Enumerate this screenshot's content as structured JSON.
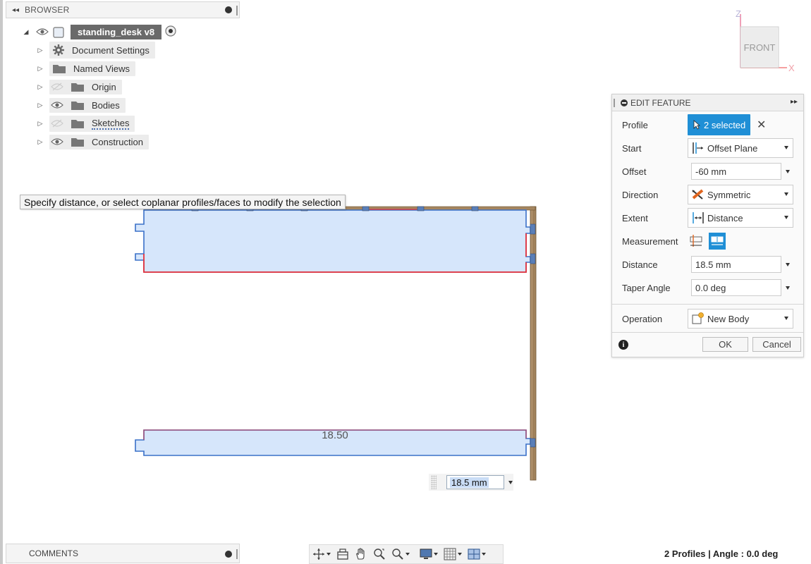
{
  "browser": {
    "title": "BROWSER",
    "root_label": "standing_desk v8",
    "items": [
      {
        "label": "Document Settings",
        "icon": "gear-icon",
        "visible_toggle": false
      },
      {
        "label": "Named Views",
        "icon": "folder-icon",
        "visible_toggle": false
      },
      {
        "label": "Origin",
        "icon": "folder-icon",
        "visible_toggle": "hidden"
      },
      {
        "label": "Bodies",
        "icon": "folder-icon",
        "visible_toggle": "shown"
      },
      {
        "label": "Sketches",
        "icon": "folder-icon",
        "visible_toggle": "hidden"
      },
      {
        "label": "Construction",
        "icon": "folder-icon",
        "visible_toggle": "shown"
      }
    ]
  },
  "viewcube": {
    "face": "FRONT",
    "axis_z": "Z",
    "axis_x": "X"
  },
  "tooltip": "Specify distance, or select coplanar profiles/faces to modify the selection",
  "scene": {
    "dimension_text": "18.50",
    "dimension_input": "18.5 mm"
  },
  "edit_feature": {
    "title": "EDIT FEATURE",
    "profile_label": "Profile",
    "profile_value": "2 selected",
    "start_label": "Start",
    "start_value": "Offset Plane",
    "offset_label": "Offset",
    "offset_value": "-60 mm",
    "direction_label": "Direction",
    "direction_value": "Symmetric",
    "extent_label": "Extent",
    "extent_value": "Distance",
    "measurement_label": "Measurement",
    "distance_label": "Distance",
    "distance_value": "18.5 mm",
    "taper_label": "Taper Angle",
    "taper_value": "0.0 deg",
    "operation_label": "Operation",
    "operation_value": "New Body",
    "ok_label": "OK",
    "cancel_label": "Cancel",
    "accent_color": "#1f8fd6"
  },
  "comments": {
    "title": "COMMENTS"
  },
  "status_bar": {
    "text": "2 Profiles | Angle : 0.0 deg"
  },
  "colors": {
    "profile_fill": "#d6e6fb",
    "profile_edge_red": "#e8333b",
    "profile_edge_blue": "#3a70c8",
    "wood": "#a58660"
  }
}
